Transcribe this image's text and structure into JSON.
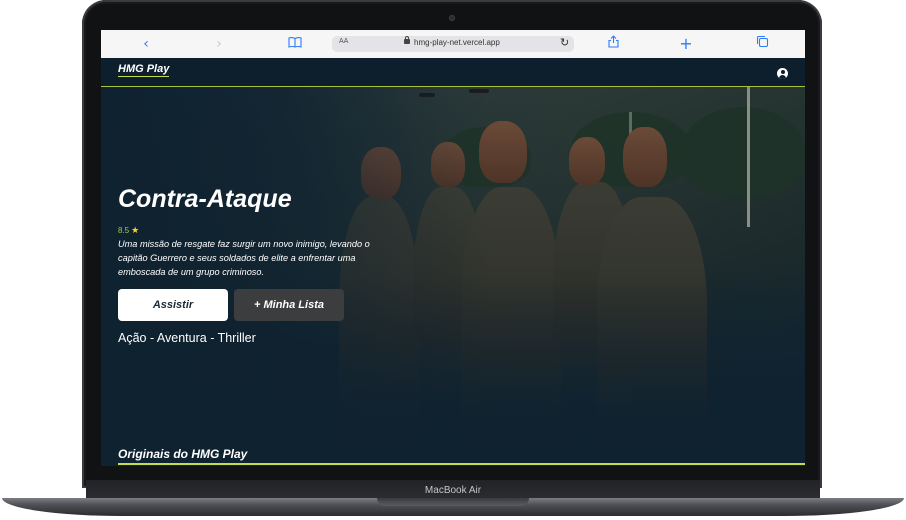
{
  "device": {
    "brand_label": "MacBook Air"
  },
  "browser": {
    "aa_label": "AA",
    "url": "hmg-play-net.vercel.app",
    "back_icon": "chevron-left-icon",
    "forward_icon": "chevron-right-icon",
    "bookmarks_icon": "book-icon",
    "reload_icon": "reload-icon",
    "share_icon": "share-icon",
    "new_tab_icon": "plus-icon",
    "tabs_icon": "tabs-icon"
  },
  "site": {
    "logo": "HMG Play",
    "user_icon": "user-circle-icon",
    "accent_color": "#c7dc4a",
    "background_color": "#0f2230"
  },
  "hero": {
    "title": "Contra-Ataque",
    "rating": "8.5",
    "rating_icon": "star-icon",
    "synopsis": "Uma missão de resgate faz surgir um novo inimigo, levando o capitão Guerrero e seus soldados de elite a enfrentar uma emboscada de um grupo criminoso.",
    "watch_label": "Assistir",
    "add_list_label": "+ Minha Lista",
    "genres": "Ação - Aventura - Thriller"
  },
  "sections": [
    {
      "title": "Originais do HMG Play"
    }
  ]
}
